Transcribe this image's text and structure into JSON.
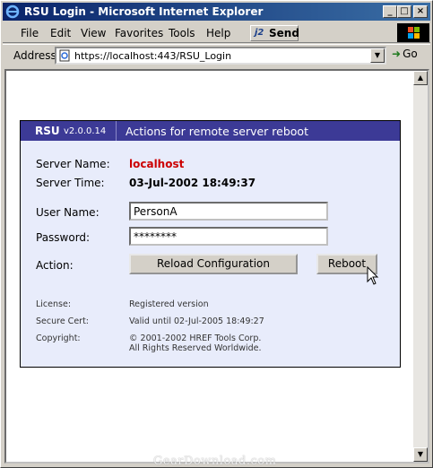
{
  "window": {
    "title": "RSU Login - Microsoft Internet Explorer",
    "minimize": "_",
    "maximize": "□",
    "close": "×"
  },
  "menu": {
    "items": [
      "File",
      "Edit",
      "View",
      "Favorites",
      "Tools",
      "Help"
    ],
    "send_prefix": "j2",
    "send_label": "Send"
  },
  "address": {
    "label": "Address",
    "url": "https://localhost:443/RSU_Login",
    "go_label": "Go"
  },
  "panel": {
    "name": "RSU",
    "version": "v2.0.0.14",
    "description": "Actions for remote server reboot",
    "server_name_label": "Server Name:",
    "server_name": "localhost",
    "server_time_label": "Server Time:",
    "server_time": "03-Jul-2002 18:49:37",
    "username_label": "User Name:",
    "username": "PersonA",
    "password_label": "Password:",
    "password_mask": "********",
    "action_label": "Action:",
    "reload_button": "Reload Configuration",
    "reboot_button": "Reboot",
    "license_label": "License:",
    "license_value": "Registered version",
    "cert_label": "Secure Cert:",
    "cert_value": "Valid until 02-Jul-2005 18:49:27",
    "copyright_label": "Copyright:",
    "copyright_line1": "© 2001-2002 HREF Tools Corp.",
    "copyright_line2": "All Rights Reserved Worldwide."
  },
  "watermark": "GearDownload.com",
  "colors": {
    "panel_header": "#3c3a96",
    "panel_bg": "#e8ecfb",
    "server_name": "#cc0000"
  }
}
